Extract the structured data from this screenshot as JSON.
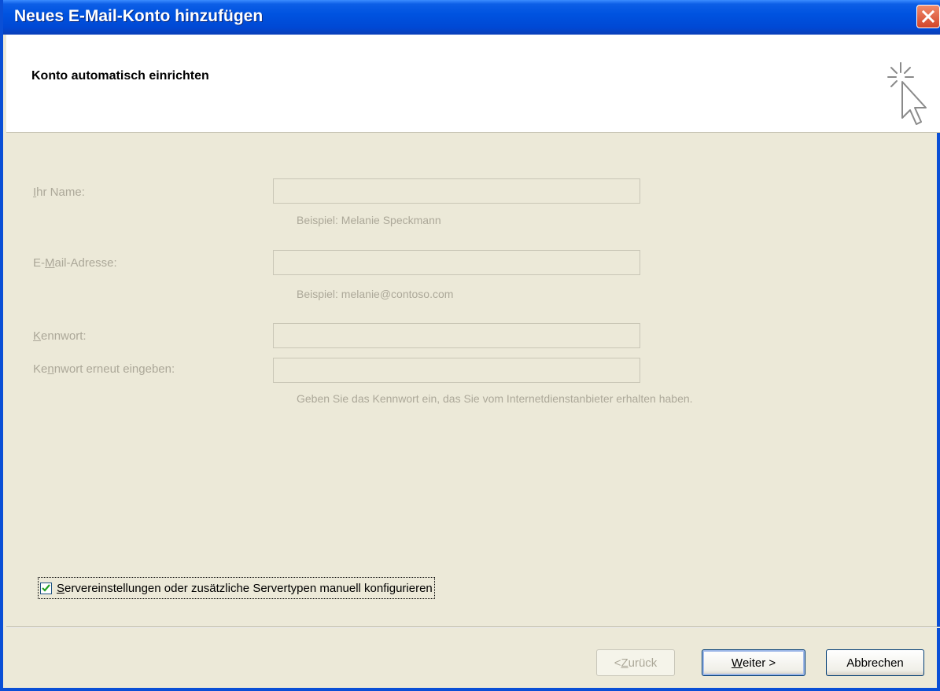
{
  "window": {
    "title": "Neues E-Mail-Konto hinzufügen"
  },
  "header": {
    "title": "Konto automatisch einrichten",
    "icon": "wizard-cursor-icon"
  },
  "form": {
    "name_label_key": "I",
    "name_label_rest": "hr Name:",
    "name_value": "",
    "name_hint": "Beispiel: Melanie Speckmann",
    "email_label_pre": "E-",
    "email_label_key": "M",
    "email_label_rest": "ail-Adresse:",
    "email_value": "",
    "email_hint": "Beispiel: melanie@contoso.com",
    "password_label_key": "K",
    "password_label_rest": "ennwort:",
    "password_value": "",
    "password_confirm_label_pre": "Ke",
    "password_confirm_label_key": "n",
    "password_confirm_label_rest": "nwort erneut eingeben:",
    "password_confirm_value": "",
    "password_hint": "Geben Sie das Kennwort ein, das Sie vom Internetdienstanbieter erhalten haben."
  },
  "manual_config": {
    "checked": true,
    "label_key": "S",
    "label_rest": "ervereinstellungen oder zusätzliche Servertypen manuell konfigurieren"
  },
  "buttons": {
    "back_pre": "< ",
    "back_key": "Z",
    "back_rest": "urück",
    "next_key": "W",
    "next_rest": "eiter >",
    "cancel": "Abbrechen"
  },
  "colors": {
    "titlebar": "#0054E3",
    "dialog_bg": "#ECE9D8",
    "disabled_text": "#ACA899"
  }
}
